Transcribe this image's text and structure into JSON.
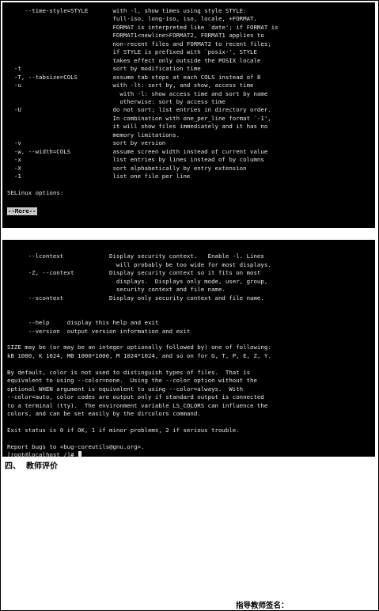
{
  "terminal_top": {
    "lines": [
      "     --time-style=STYLE       with -l, show times using style STYLE:",
      "                              full-iso, long-iso, iso, locale, +FORMAT.",
      "                              FORMAT is interpreted like `date'; if FORMAT is",
      "                              FORMAT1<newline>FORMAT2, FORMAT1 applies to",
      "                              non-recent files and FORMAT2 to recent files;",
      "                              if STYLE is prefixed with `posix-', STYLE",
      "                              takes effect only outside the POSIX locale",
      "  -t                          sort by modification time",
      "  -T, --tabsize=COLS          assume tab stops at each COLS instead of 8",
      "  -u                          with -lt: sort by, and show, access time",
      "                                with -l: show access time and sort by name",
      "                                otherwise: sort by access time",
      "  -U                          do not sort; list entries in directory order.",
      "                              In combination with one_per_line format `-1',",
      "                              it will show files immediately and it has no",
      "                              memory limitations.",
      "  -v                          sort by version",
      "  -w, --width=COLS            assume screen width instead of current value",
      "  -x                          list entries by lines instead of by columns",
      "  -X                          sort alphabetically by entry extension",
      "  -1                          list one file per line",
      "",
      "SELinux options:",
      ""
    ],
    "more_prompt": "--More--"
  },
  "terminal_bottom": {
    "lines": [
      "",
      "      --lcontext             Display security context.   Enable -l. Lines",
      "                               will probably be too wide for most displays.",
      "      -Z, --context          Display security context so it fits on most",
      "                               displays.  Displays only mode, user, group,",
      "                               security context and file name.",
      "      --scontext             Display only security context and file name.",
      "",
      "",
      "      --help     display this help and exit",
      "      --version  output version information and exit",
      "",
      "SIZE may be (or may be an integer optionally followed by) one of following:",
      "kB 1000, K 1024, MB 1000*1000, M 1024*1024, and so on for G, T, P, E, Z, Y.",
      "",
      "By default, color is not used to distinguish types of files.  That is",
      "equivalent to using --color=none.  Using the --color option without the",
      "optional WHEN argument is equivalent to using --color=always.  With",
      "--color=auto, color codes are output only if standard output is connected",
      "to a terminal (tty).  The environment variable LS_COLORS can influence the",
      "colors, and can be set easily by the dircolors command.",
      "",
      "Exit status is 0 if OK, 1 if minor problems, 2 if serious trouble.",
      "",
      "Report bugs to <bug-coreutils@gnu.org>."
    ],
    "prompt": "[root@localhost /]# "
  },
  "section_heading": "四、  教师评价",
  "signature_label": "指导教师签名："
}
